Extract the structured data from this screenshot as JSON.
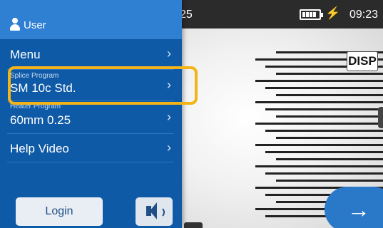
{
  "statusbar": {
    "left_number": "25",
    "clock": "09:23",
    "battery_icon": "battery-full-icon",
    "charging_icon": "charging-bolt-icon"
  },
  "panel": {
    "user_label": "User",
    "items": [
      {
        "sub": "",
        "label": "Menu"
      },
      {
        "sub": "Splice Program",
        "label": "SM 10c Std."
      },
      {
        "sub": "Heater Program",
        "label": "60mm 0.25"
      },
      {
        "sub": "",
        "label": "Help Video"
      }
    ],
    "chevron": "›",
    "login_label": "Login",
    "speaker_icon": "speaker-icon"
  },
  "view": {
    "disp_label": "DISP",
    "next_arrow": "→"
  },
  "colors": {
    "panel_bg": "#0f5aa6",
    "panel_header": "#2f7fd3",
    "highlight": "#f2b418",
    "next_button": "#2a78c8",
    "statusbar": "#2b2b2b"
  }
}
